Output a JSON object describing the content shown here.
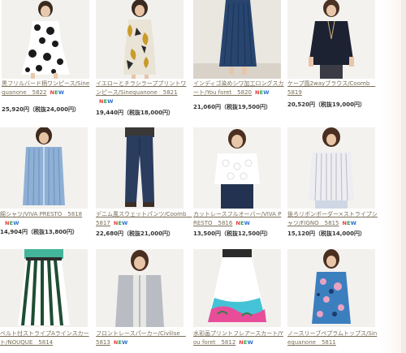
{
  "new_badge": [
    "N",
    "E",
    "W"
  ],
  "products": [
    {
      "title": "黒フリルバード柄ワンピース/Sinequanone　5822",
      "price": "25,920円（税抜24,000円）",
      "new": true
    },
    {
      "title": "イエローとチラシラーププリントワンピース/Sinequanone　5821",
      "price": "19,440円（税抜18,000円）",
      "new": true
    },
    {
      "title": "インディゴ染めシワ加工ロングスカート/You foret　5820",
      "price": "21,060円（税抜19,500円）",
      "new": true
    },
    {
      "title": "ケープ風2wayブラウス/Coomb　5819",
      "price": "20,520円（税抜19,000円）",
      "new": true
    },
    {
      "title": "綿シャツ/VIVA PRESTO　5818",
      "price": "14,904円（税抜13,800円）",
      "new": true
    },
    {
      "title": "デニム風スウェットパンツ/Coomb　5817",
      "price": "22,680円（税抜21,000円）",
      "new": true
    },
    {
      "title": "カットレースフルオーバー/VIVA PRESTO　5816",
      "price": "13,500円（税抜12,500円）",
      "new": true
    },
    {
      "title": "後ろリボンボーダー×ストライプシャツ/FIGNO　5815",
      "price": "15,120円（税抜14,000円）",
      "new": true
    },
    {
      "title": "ベルト付ストライプAラインスカート/NOUQUE　5814",
      "price": "",
      "new": false
    },
    {
      "title": "フロントレースパーカー/Civilise　5813",
      "price": "",
      "new": true
    },
    {
      "title": "水彩画プリントフレアースカート/You foret　5812",
      "price": "",
      "new": true
    },
    {
      "title": "ノースリーブペプラムトップス/Sinequanone　5811",
      "price": "",
      "new": true
    }
  ]
}
